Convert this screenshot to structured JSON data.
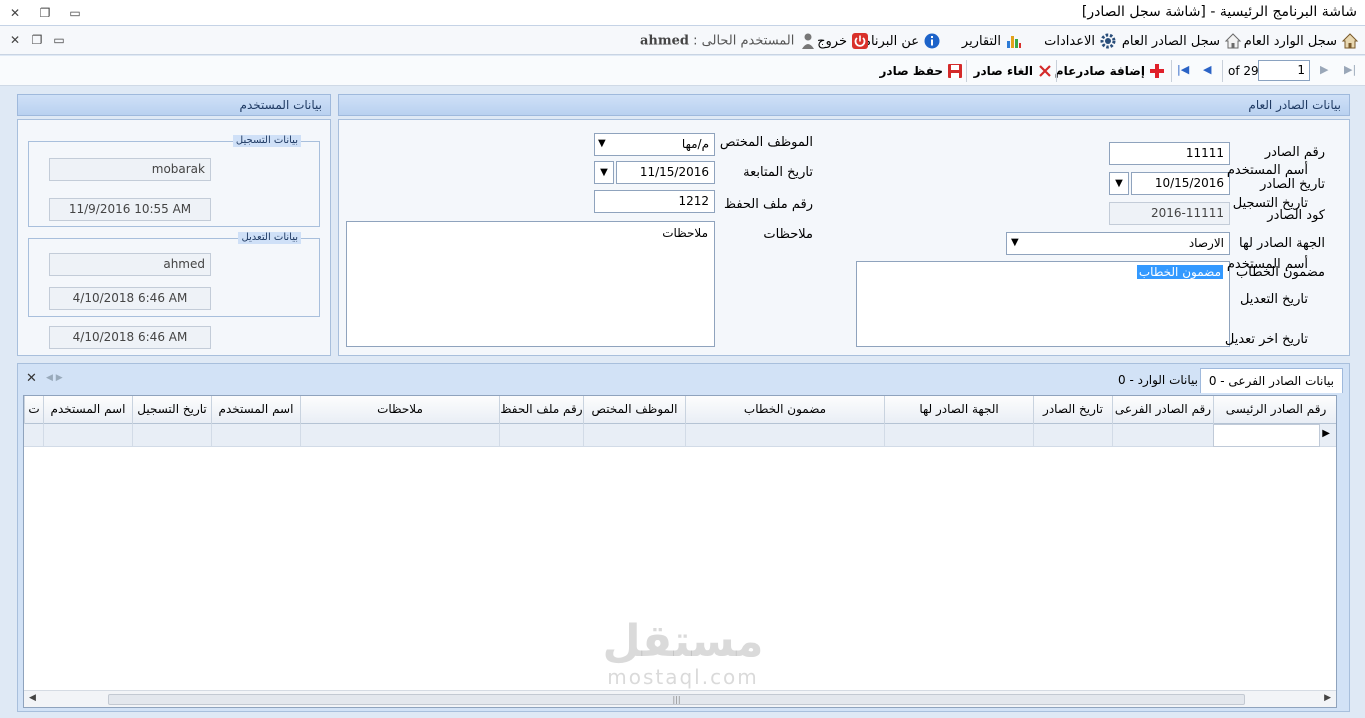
{
  "window": {
    "title": "شاشة البرنامج الرئيسية - [شاشة سجل الصادر]"
  },
  "menu": {
    "incoming": "سجل الوارد العام",
    "outgoing": "سجل الصادر العام",
    "settings": "الاعدادات",
    "reports": "التقارير",
    "about": "عن البرنامج",
    "exit": "خروج",
    "current_user_label": "المستخدم الحالى :",
    "current_user": "ahmed"
  },
  "toolbar": {
    "save": "حفظ صادر",
    "cancel": "الغاء صادر",
    "add": "إضافة صادرعام",
    "page_value": "1",
    "page_of": "of 29"
  },
  "outgoing_panel": {
    "title": "بيانات الصادر العام",
    "number_label": "رقم الصادر",
    "number_value": "11111",
    "date_label": "تاريخ الصادر",
    "date_value": "10/15/2016",
    "code_label": "كود الصادر",
    "code_value": "2016-11111",
    "recipient_label": "الجهة الصادر لها",
    "recipient_value": "الارصاد",
    "content_label": "مضمون الخطاب",
    "content_value": "مضمون الخطاب",
    "employee_label": "الموظف المختص",
    "employee_value": "م/مها",
    "followup_label": "تاريخ المتابعة",
    "followup_value": "11/15/2016",
    "file_label": "رقم ملف الحفظ",
    "file_value": "1212",
    "notes_label": "ملاحظات",
    "notes_value": "ملاحظات"
  },
  "user_panel": {
    "title": "بيانات المستخدم",
    "reg_group": "بيانات التسجيل",
    "reg_user_label": "أسم المستخدم",
    "reg_user_value": "mobarak",
    "reg_date_label": "تاريخ التسجيل",
    "reg_date_value": "11/9/2016 10:55 AM",
    "mod_group": "بيانات التعديل",
    "mod_user_label": "أسم المستخدم",
    "mod_user_value": "ahmed",
    "mod_date_label": "تاريخ التعديل",
    "mod_date_value": "4/10/2018 6:46 AM",
    "last_mod_label": "تاريخ اخر تعديل",
    "last_mod_value": "4/10/2018 6:46 AM"
  },
  "tabs": {
    "sub_outgoing": "بيانات الصادر الفرعى - 0",
    "incoming": "بيانات الوارد - 0"
  },
  "grid": {
    "columns": [
      "رقم الصادر الرئيسى",
      "رقم الصادر الفرعى",
      "تاريخ الصادر",
      "الجهة الصادر لها",
      "مضمون الخطاب",
      "الموظف المختص",
      "رقم ملف الحفظ",
      "ملاحظات",
      "اسم المستخدم",
      "تاريخ التسجيل",
      "اسم المستخدم",
      "ت"
    ]
  },
  "watermark": {
    "main": "مستقل",
    "sub": "mostaql.com"
  },
  "colors": {
    "panel_header": "#b9d1f0",
    "selection": "#3399ff",
    "exit_red": "#d9312b"
  }
}
